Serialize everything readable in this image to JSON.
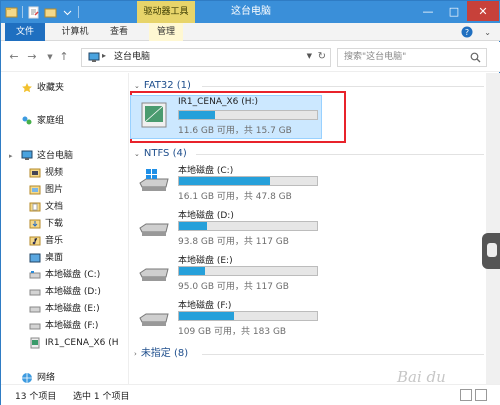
{
  "window": {
    "title": "这台电脑",
    "context_tab": "驱动器工具",
    "accent": "#3a8fd9",
    "context_tab_color": "#e7d46a",
    "close_color": "#c7413a"
  },
  "ribbon": {
    "tabs": [
      "文件",
      "计算机",
      "查看",
      "管理"
    ]
  },
  "address": {
    "path": "这台电脑",
    "separator": "▸",
    "search_placeholder": "搜索\"这台电脑\""
  },
  "sidebar": {
    "items": [
      {
        "label": "收藏夹",
        "icon": "star-icon"
      },
      {
        "label": "家庭组",
        "icon": "homegroup-icon"
      },
      {
        "label": "这台电脑",
        "icon": "computer-icon"
      },
      {
        "label": "视频",
        "icon": "videos-folder-icon"
      },
      {
        "label": "图片",
        "icon": "pictures-folder-icon"
      },
      {
        "label": "文档",
        "icon": "documents-folder-icon"
      },
      {
        "label": "下载",
        "icon": "downloads-folder-icon"
      },
      {
        "label": "音乐",
        "icon": "music-folder-icon"
      },
      {
        "label": "桌面",
        "icon": "desktop-folder-icon"
      },
      {
        "label": "本地磁盘 (C:)",
        "icon": "drive-icon"
      },
      {
        "label": "本地磁盘 (D:)",
        "icon": "drive-icon"
      },
      {
        "label": "本地磁盘 (E:)",
        "icon": "drive-icon"
      },
      {
        "label": "本地磁盘 (F:)",
        "icon": "drive-icon"
      },
      {
        "label": "IR1_CENA_X6 (H",
        "icon": "usb-drive-icon"
      },
      {
        "label": "网络",
        "icon": "network-icon"
      }
    ]
  },
  "groups": [
    {
      "label": "FAT32 (1)"
    },
    {
      "label": "NTFS (4)"
    },
    {
      "label": "未指定 (8)"
    }
  ],
  "drives": [
    {
      "name": "IR1_CENA_X6 (H:)",
      "info": "11.6 GB 可用，共 15.7 GB",
      "used_fraction": 0.26
    },
    {
      "name": "本地磁盘 (C:)",
      "info": "16.1 GB 可用，共 47.8 GB",
      "used_fraction": 0.66
    },
    {
      "name": "本地磁盘 (D:)",
      "info": "93.8 GB 可用，共 117 GB",
      "used_fraction": 0.2
    },
    {
      "name": "本地磁盘 (E:)",
      "info": "95.0 GB 可用，共 117 GB",
      "used_fraction": 0.19
    },
    {
      "name": "本地磁盘 (F:)",
      "info": "109 GB 可用，共 183 GB",
      "used_fraction": 0.4
    }
  ],
  "status": {
    "count": "13 个项目",
    "selected": "选中 1 个项目"
  },
  "bar_color": "#26a0da"
}
